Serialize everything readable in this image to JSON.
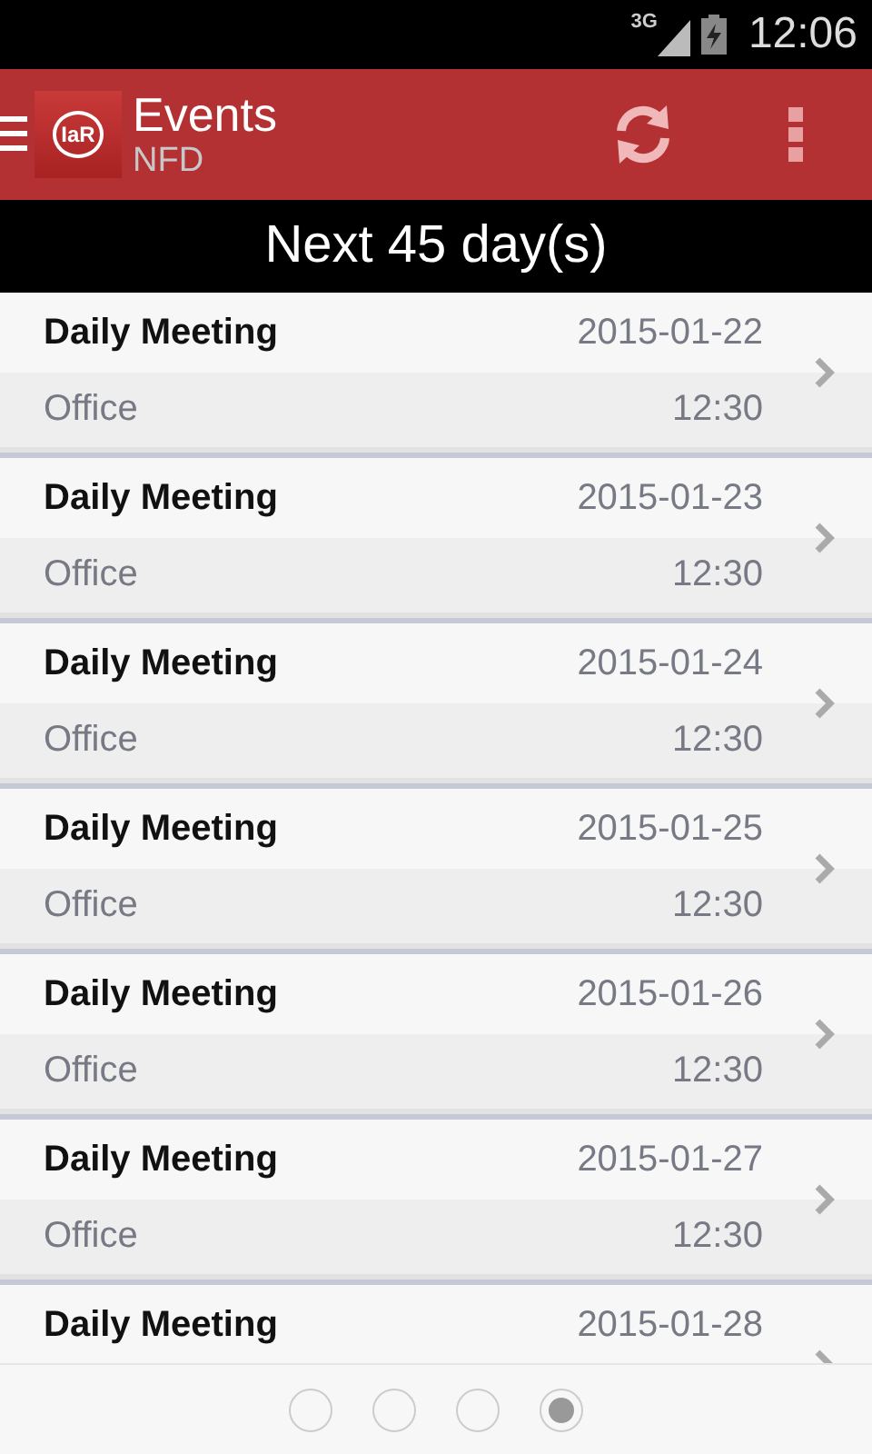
{
  "status_bar": {
    "network": "3G",
    "time": "12:06"
  },
  "action_bar": {
    "title": "Events",
    "subtitle": "NFD",
    "logo_text": "IaR"
  },
  "header": "Next 45 day(s)",
  "events": [
    {
      "title": "Daily Meeting",
      "date": "2015-01-22",
      "location": "Office",
      "time": "12:30"
    },
    {
      "title": "Daily Meeting",
      "date": "2015-01-23",
      "location": "Office",
      "time": "12:30"
    },
    {
      "title": "Daily Meeting",
      "date": "2015-01-24",
      "location": "Office",
      "time": "12:30"
    },
    {
      "title": "Daily Meeting",
      "date": "2015-01-25",
      "location": "Office",
      "time": "12:30"
    },
    {
      "title": "Daily Meeting",
      "date": "2015-01-26",
      "location": "Office",
      "time": "12:30"
    },
    {
      "title": "Daily Meeting",
      "date": "2015-01-27",
      "location": "Office",
      "time": "12:30"
    },
    {
      "title": "Daily Meeting",
      "date": "2015-01-28"
    }
  ],
  "pages": [
    {
      "selected": false
    },
    {
      "selected": false
    },
    {
      "selected": false
    },
    {
      "selected": true
    }
  ]
}
